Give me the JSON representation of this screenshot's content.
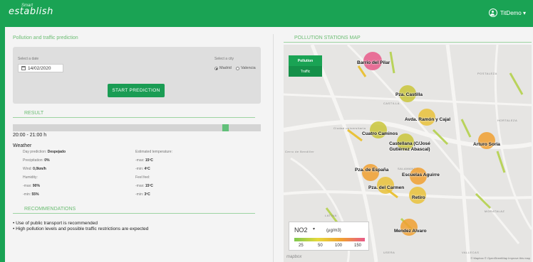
{
  "header": {
    "logo_top": "Smart",
    "logo": "establish",
    "user": "TitDemo ▾"
  },
  "prediction": {
    "title": "Pollution and traffic prediction",
    "date_label": "Select a date",
    "date_value": "14/02/2020",
    "city_label": "Select a city",
    "city_options": [
      "Madrid",
      "Valencia"
    ],
    "selected_city": "Madrid",
    "start_button": "START PREDICTION"
  },
  "result": {
    "title": "RESULT",
    "time_range": "20:00 - 21:00 h",
    "slider_position": 0.9,
    "weather_title": "Weather",
    "rows": [
      {
        "label": "Day prediction:",
        "value": "Despejado",
        "label2": "Estimated temperature:",
        "value2": ""
      },
      {
        "label": "Precipitation:",
        "value": "0%",
        "label2": "-max:",
        "value2": "15ºC"
      },
      {
        "label": "Wind:",
        "value": "0,0km/h",
        "label2": "-min:",
        "value2": "4ºC"
      },
      {
        "label": "Humidity:",
        "value": "",
        "label2": "Feel feel:",
        "value2": ""
      },
      {
        "label": "-max:",
        "value": "90%",
        "label2": "-max:",
        "value2": "15ºC"
      },
      {
        "label": "-min:",
        "value": "55%",
        "label2": "-min:",
        "value2": "3ºC"
      }
    ]
  },
  "recommendations": {
    "title": "RECOMMENDATIONS",
    "items": [
      "Use of public transport is recommended",
      "High pollution levels and possible traffic restrictions are expected"
    ]
  },
  "map": {
    "title": "POLLUTION STATIONS MAP",
    "layers": [
      "Pollution",
      "Traffic"
    ],
    "selected_layer": "Pollution",
    "stations": [
      {
        "name": "Barrio del Pilar",
        "color": "#e85a8a"
      },
      {
        "name": "Pza. Castilla",
        "color": "#c9c53a"
      },
      {
        "name": "Avda. Ramón y Cajal",
        "color": "#e9c23a"
      },
      {
        "name": "Cuatro Caminos",
        "color": "#c9c53a"
      },
      {
        "name": "Castellana (C/José Gutiérrez Abascal)",
        "color": "#c9c53a"
      },
      {
        "name": "Arturo Soria",
        "color": "#f0a030"
      },
      {
        "name": "Pza. de España",
        "color": "#f0a030"
      },
      {
        "name": "Escuelas Aguirre",
        "color": "#f0a030"
      },
      {
        "name": "Pza. del Carmen",
        "color": "#e9c23a"
      },
      {
        "name": "Retiro",
        "color": "#e9c23a"
      },
      {
        "name": "Mendez Alvaro",
        "color": "#f0a030"
      }
    ],
    "road_labels": [
      "POSTALEZA",
      "CASTILLA",
      "Ciudad universitaria",
      "Cerro de Bendiller",
      "SALAMANCA",
      "LATINA",
      "MORATALAZ",
      "VALLECAS",
      "USERA",
      "HORTALEZA"
    ],
    "legend": {
      "pollutant": "NO2",
      "caret": "▾",
      "unit": "(μg/m3)",
      "ticks": [
        "25",
        "50",
        "100",
        "150"
      ]
    },
    "logo": "mapbox",
    "attribution": "© Mapbox © OpenStreetMap  Improve this map"
  }
}
